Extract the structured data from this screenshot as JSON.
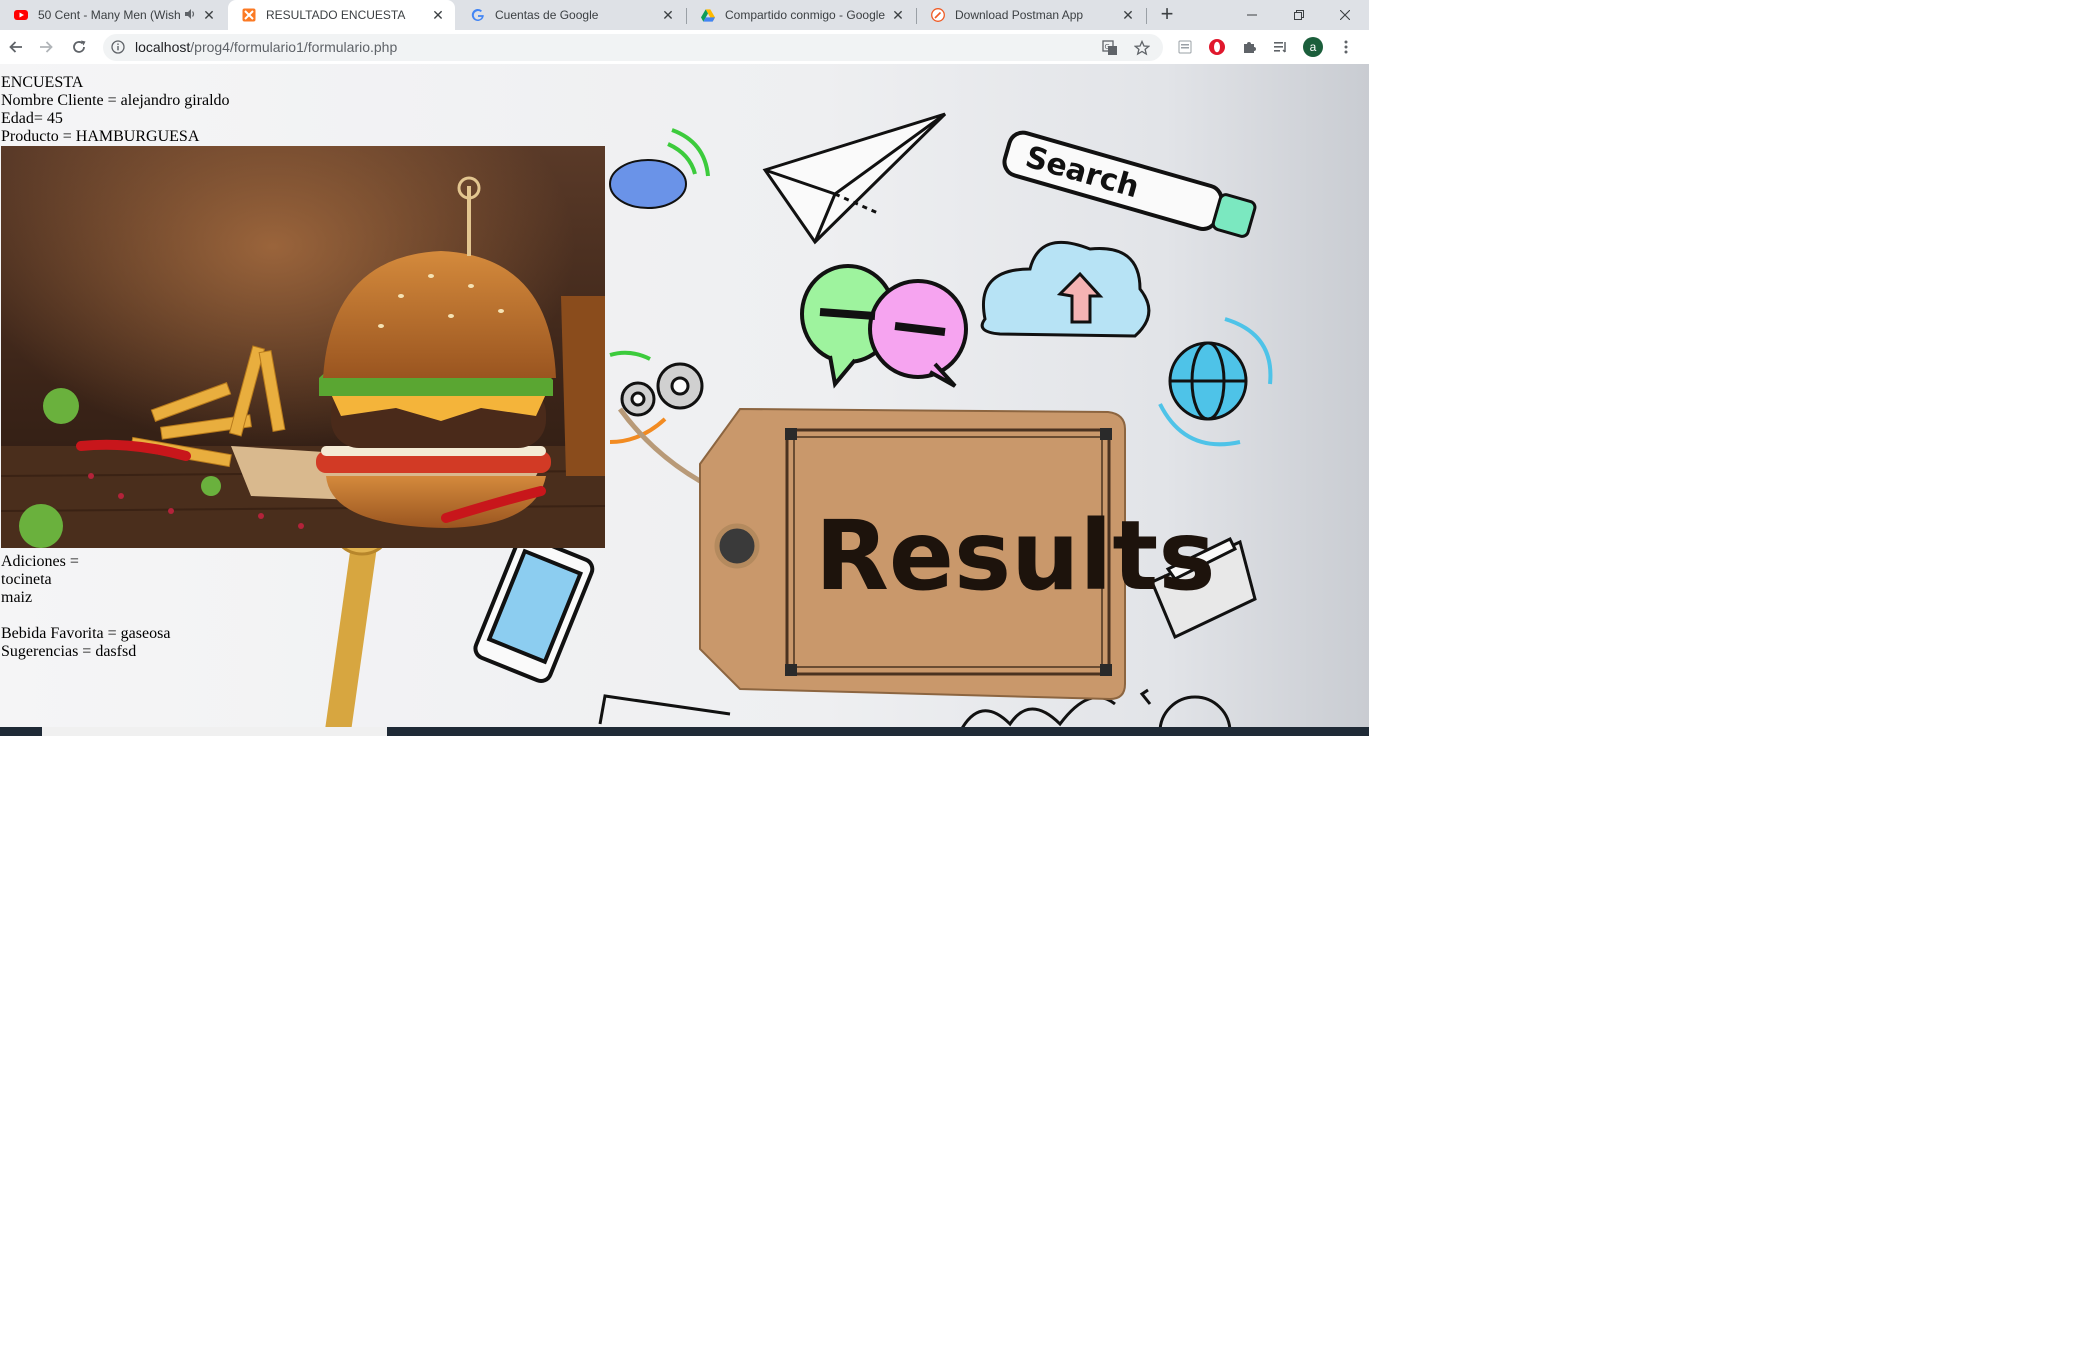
{
  "browser": {
    "tabs": [
      {
        "title": "50 Cent - Many Men (Wish",
        "favicon": "youtube-icon",
        "audio": true,
        "active": false
      },
      {
        "title": "RESULTADO ENCUESTA",
        "favicon": "xampp-icon",
        "audio": false,
        "active": true
      },
      {
        "title": "Cuentas de Google",
        "favicon": "google-icon",
        "audio": false,
        "active": false
      },
      {
        "title": "Compartido conmigo - Google",
        "favicon": "drive-icon",
        "audio": false,
        "active": false
      },
      {
        "title": "Download Postman App",
        "favicon": "postman-icon",
        "audio": false,
        "active": false
      }
    ],
    "new_tab": "+",
    "address": {
      "host": "localhost",
      "path": "/prog4/formulario1/formulario.php"
    },
    "profile_initial": "a"
  },
  "page": {
    "title": "ENCUESTA",
    "nombre": "Nombre Cliente = alejandro giraldo",
    "edad": "Edad= 45",
    "producto": "Producto = HAMBURGUESA",
    "adiciones_label": "Adiciones =",
    "adiciones": [
      "tocineta",
      "maiz"
    ],
    "bebida": "Bebida Favorita = gaseosa",
    "sugerencias": "Sugerencias = dasfsd",
    "background_word": "Results",
    "background_search": "Search"
  },
  "colors": {
    "tabstrip": "#dee1e6",
    "omnibox": "#f1f3f4",
    "tag": "#c9986b"
  }
}
